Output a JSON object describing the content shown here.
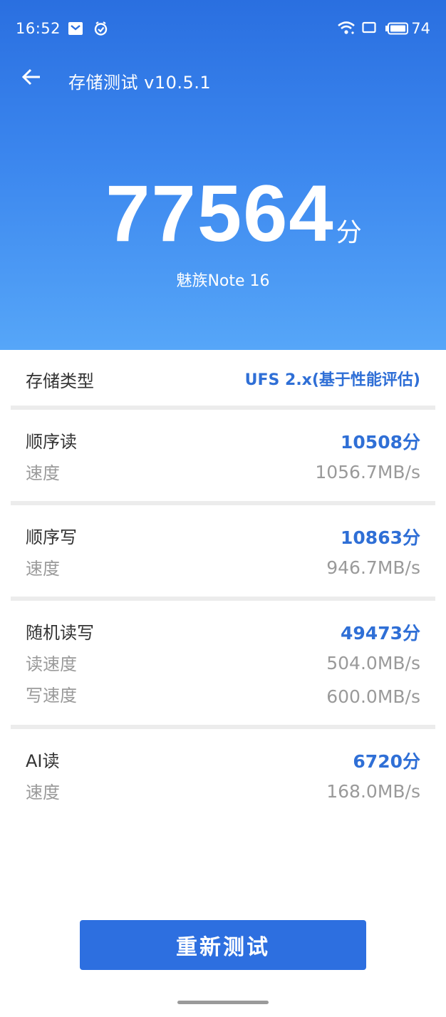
{
  "status_bar": {
    "time": "16:52",
    "battery": "74",
    "icons": [
      "mail-icon",
      "clock-check-icon",
      "wifi-icon",
      "screen-icon",
      "battery-icon"
    ]
  },
  "nav": {
    "title": "存储测试 v10.5.1",
    "back_icon": "arrow-left-icon"
  },
  "score": {
    "value": "77564",
    "unit": "分",
    "device": "魅族Note 16"
  },
  "storage_type": {
    "label": "存储类型",
    "value": "UFS 2.x(基于性能评估)"
  },
  "sections": [
    {
      "title": "顺序读",
      "score": "10508分",
      "rows": [
        {
          "label": "速度",
          "value": "1056.7MB/s"
        }
      ]
    },
    {
      "title": "顺序写",
      "score": "10863分",
      "rows": [
        {
          "label": "速度",
          "value": "946.7MB/s"
        }
      ]
    },
    {
      "title": "随机读写",
      "score": "49473分",
      "rows": [
        {
          "label": "读速度",
          "value": "504.0MB/s"
        },
        {
          "label": "写速度",
          "value": "600.0MB/s"
        }
      ]
    },
    {
      "title": "AI读",
      "score": "6720分",
      "rows": [
        {
          "label": "速度",
          "value": "168.0MB/s"
        }
      ]
    }
  ],
  "retest_button": "重新测试",
  "colors": {
    "accent": "#2f6fd6",
    "header_top": "#2a6fe0",
    "header_bottom": "#56a6f8",
    "muted": "#9a9a9a"
  }
}
